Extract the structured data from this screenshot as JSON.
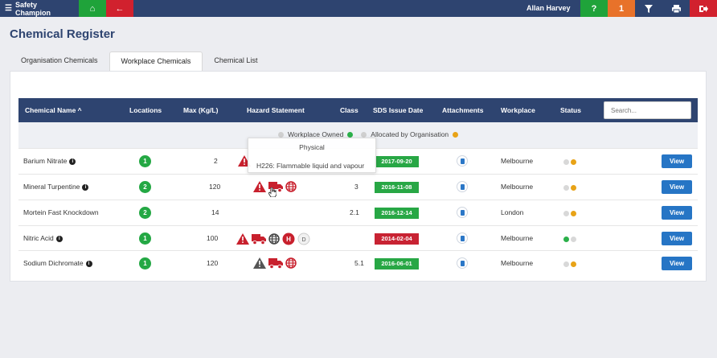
{
  "topbar": {
    "brand": "Safety Champion",
    "user": "Allan Harvey",
    "help_label": "?",
    "notif_count": "1"
  },
  "page_title": "Chemical Register",
  "tabs": [
    {
      "label": "Organisation Chemicals"
    },
    {
      "label": "Workplace Chemicals"
    },
    {
      "label": "Chemical List"
    }
  ],
  "table": {
    "headers": {
      "name": "Chemical Name ^",
      "locations": "Locations",
      "max": "Max (Kg/L)",
      "hazard": "Hazard Statement",
      "class": "Class",
      "sds": "SDS Issue Date",
      "attachments": "Attachments",
      "workplace": "Workplace",
      "status": "Status"
    },
    "search_placeholder": "Search...",
    "legend": {
      "owned": "Workplace Owned",
      "allocated": "Allocated by Organisation"
    },
    "rows": [
      {
        "name": "Barium Nitrate",
        "locations": "1",
        "max": "2",
        "class": "",
        "sds": "2017-09-20",
        "sds_status": "green",
        "workplace": "Melbourne",
        "view": "View"
      },
      {
        "name": "Mineral Turpentine",
        "locations": "2",
        "max": "120",
        "class": "3",
        "sds": "2016-11-08",
        "sds_status": "green",
        "workplace": "Melbourne",
        "view": "View"
      },
      {
        "name": "Mortein Fast Knockdown",
        "locations": "2",
        "max": "14",
        "class": "2.1",
        "sds": "2016-12-14",
        "sds_status": "green",
        "workplace": "London",
        "view": "View"
      },
      {
        "name": "Nitric Acid",
        "locations": "1",
        "max": "100",
        "class": "",
        "sds": "2014-02-04",
        "sds_status": "red",
        "workplace": "Melbourne",
        "view": "View"
      },
      {
        "name": "Sodium Dichromate",
        "locations": "1",
        "max": "120",
        "class": "5.1",
        "sds": "2016-06-01",
        "sds_status": "green",
        "workplace": "Melbourne",
        "view": "View"
      }
    ]
  },
  "tooltip": {
    "title": "Physical",
    "body": "H226: Flammable liquid and vapour"
  },
  "colors": {
    "navy": "#2e4470",
    "green": "#28a745",
    "red": "#c82333",
    "orange": "#e8a317",
    "blue": "#2675c5"
  }
}
